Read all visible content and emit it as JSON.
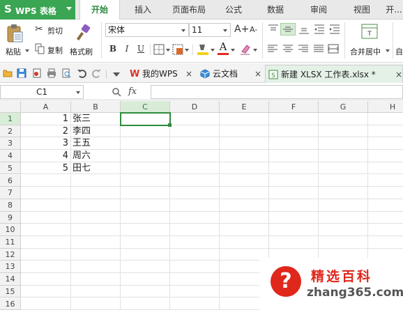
{
  "app": {
    "logo_glyph": "S",
    "title": "WPS 表格"
  },
  "ribbon_tabs": [
    "开始",
    "插入",
    "页面布局",
    "公式",
    "数据",
    "审阅",
    "视图",
    "开..."
  ],
  "active_tab": "开始",
  "ribbon": {
    "paste_label": "粘贴",
    "cut_label": "剪切",
    "copy_label": "复制",
    "format_painter_label": "格式刷",
    "font_name": "宋体",
    "font_size": "11",
    "bold": "B",
    "italic": "I",
    "underline": "U",
    "grow_font": "A+",
    "shrink_font": "A-",
    "merge_center_label": "合并居中",
    "auto_label": "自"
  },
  "doc_tabs": [
    {
      "label": "我的WPS",
      "close": "×"
    },
    {
      "label": "云文档",
      "close": "×"
    },
    {
      "label": "新建 XLSX 工作表.xlsx *",
      "close": "×"
    }
  ],
  "formula_bar": {
    "name_box": "C1",
    "fx": "fx",
    "value": ""
  },
  "columns": [
    "A",
    "B",
    "C",
    "D",
    "E",
    "F",
    "G",
    "H"
  ],
  "selected_column": "C",
  "rows": [
    "1",
    "2",
    "3",
    "4",
    "5",
    "6",
    "7",
    "8",
    "9",
    "10",
    "11",
    "12",
    "13",
    "14",
    "15",
    "16"
  ],
  "selected_row": "1",
  "cells": {
    "A": [
      "1",
      "2",
      "3",
      "4",
      "5"
    ],
    "B": [
      "张三",
      "李四",
      "王五",
      "周六",
      "田七"
    ]
  },
  "watermark": {
    "glyph": "?",
    "name": "精选百科",
    "url": "zhang365.com"
  },
  "colors": {
    "accent": "#2e8b3d",
    "logo_bg": "#3aa552",
    "watermark_red": "#e0271b"
  }
}
